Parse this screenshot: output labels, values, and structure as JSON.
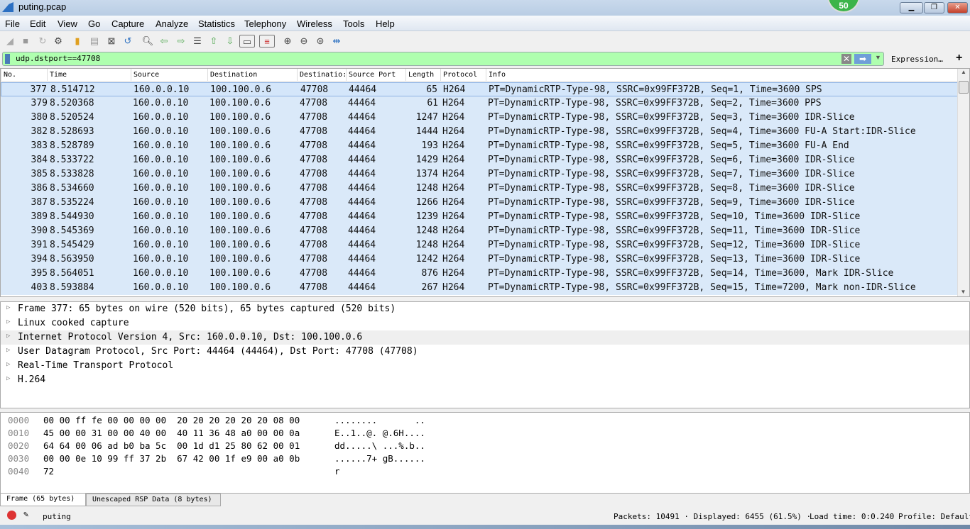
{
  "window": {
    "title": "puting.pcap",
    "badge": "50"
  },
  "menu": [
    "File",
    "Edit",
    "View",
    "Go",
    "Capture",
    "Analyze",
    "Statistics",
    "Telephony",
    "Wireless",
    "Tools",
    "Help"
  ],
  "filter": {
    "value": "udp.dstport==47708",
    "expression_label": "Expression…",
    "add_label": "+"
  },
  "columns": [
    "No.",
    "Time",
    "Source",
    "Destination",
    "Destinatio:",
    "Source Port",
    "Length",
    "Protocol",
    "Info"
  ],
  "packets": [
    [
      "377",
      "8.514712",
      "160.0.0.10",
      "100.100.0.6",
      "47708",
      "44464",
      "65",
      "H264",
      "PT=DynamicRTP-Type-98, SSRC=0x99FF372B, Seq=1, Time=3600 SPS"
    ],
    [
      "379",
      "8.520368",
      "160.0.0.10",
      "100.100.0.6",
      "47708",
      "44464",
      "61",
      "H264",
      "PT=DynamicRTP-Type-98, SSRC=0x99FF372B, Seq=2, Time=3600 PPS"
    ],
    [
      "380",
      "8.520524",
      "160.0.0.10",
      "100.100.0.6",
      "47708",
      "44464",
      "1247",
      "H264",
      "PT=DynamicRTP-Type-98, SSRC=0x99FF372B, Seq=3, Time=3600 IDR-Slice"
    ],
    [
      "382",
      "8.528693",
      "160.0.0.10",
      "100.100.0.6",
      "47708",
      "44464",
      "1444",
      "H264",
      "PT=DynamicRTP-Type-98, SSRC=0x99FF372B, Seq=4, Time=3600 FU-A Start:IDR-Slice"
    ],
    [
      "383",
      "8.528789",
      "160.0.0.10",
      "100.100.0.6",
      "47708",
      "44464",
      "193",
      "H264",
      "PT=DynamicRTP-Type-98, SSRC=0x99FF372B, Seq=5, Time=3600 FU-A End"
    ],
    [
      "384",
      "8.533722",
      "160.0.0.10",
      "100.100.0.6",
      "47708",
      "44464",
      "1429",
      "H264",
      "PT=DynamicRTP-Type-98, SSRC=0x99FF372B, Seq=6, Time=3600 IDR-Slice"
    ],
    [
      "385",
      "8.533828",
      "160.0.0.10",
      "100.100.0.6",
      "47708",
      "44464",
      "1374",
      "H264",
      "PT=DynamicRTP-Type-98, SSRC=0x99FF372B, Seq=7, Time=3600 IDR-Slice"
    ],
    [
      "386",
      "8.534660",
      "160.0.0.10",
      "100.100.0.6",
      "47708",
      "44464",
      "1248",
      "H264",
      "PT=DynamicRTP-Type-98, SSRC=0x99FF372B, Seq=8, Time=3600 IDR-Slice"
    ],
    [
      "387",
      "8.535224",
      "160.0.0.10",
      "100.100.0.6",
      "47708",
      "44464",
      "1266",
      "H264",
      "PT=DynamicRTP-Type-98, SSRC=0x99FF372B, Seq=9, Time=3600 IDR-Slice"
    ],
    [
      "389",
      "8.544930",
      "160.0.0.10",
      "100.100.0.6",
      "47708",
      "44464",
      "1239",
      "H264",
      "PT=DynamicRTP-Type-98, SSRC=0x99FF372B, Seq=10, Time=3600 IDR-Slice"
    ],
    [
      "390",
      "8.545369",
      "160.0.0.10",
      "100.100.0.6",
      "47708",
      "44464",
      "1248",
      "H264",
      "PT=DynamicRTP-Type-98, SSRC=0x99FF372B, Seq=11, Time=3600 IDR-Slice"
    ],
    [
      "391",
      "8.545429",
      "160.0.0.10",
      "100.100.0.6",
      "47708",
      "44464",
      "1248",
      "H264",
      "PT=DynamicRTP-Type-98, SSRC=0x99FF372B, Seq=12, Time=3600 IDR-Slice"
    ],
    [
      "394",
      "8.563950",
      "160.0.0.10",
      "100.100.0.6",
      "47708",
      "44464",
      "1242",
      "H264",
      "PT=DynamicRTP-Type-98, SSRC=0x99FF372B, Seq=13, Time=3600 IDR-Slice"
    ],
    [
      "395",
      "8.564051",
      "160.0.0.10",
      "100.100.0.6",
      "47708",
      "44464",
      "876",
      "H264",
      "PT=DynamicRTP-Type-98, SSRC=0x99FF372B, Seq=14, Time=3600, Mark IDR-Slice"
    ],
    [
      "403",
      "8.593884",
      "160.0.0.10",
      "100.100.0.6",
      "47708",
      "44464",
      "267",
      "H264",
      "PT=DynamicRTP-Type-98, SSRC=0x99FF372B, Seq=15, Time=7200, Mark non-IDR-Slice"
    ]
  ],
  "details": [
    "Frame 377: 65 bytes on wire (520 bits), 65 bytes captured (520 bits)",
    "Linux cooked capture",
    "Internet Protocol Version 4, Src: 160.0.0.10, Dst: 100.100.0.6",
    "User Datagram Protocol, Src Port: 44464 (44464), Dst Port: 47708 (47708)",
    "Real-Time Transport Protocol",
    "H.264"
  ],
  "hex": [
    [
      "0000",
      "00 00 ff fe 00 00 00 00  20 20 20 20 20 20 08 00",
      "........       .."
    ],
    [
      "0010",
      "45 00 00 31 00 00 40 00  40 11 36 48 a0 00 00 0a",
      "E..1..@. @.6H...."
    ],
    [
      "0020",
      "64 64 00 06 ad b0 ba 5c  00 1d d1 25 80 62 00 01",
      "dd.....\\ ...%.b.."
    ],
    [
      "0030",
      "00 00 0e 10 99 ff 37 2b  67 42 00 1f e9 00 a0 0b",
      "......7+ gB......"
    ],
    [
      "0040",
      "72",
      "r"
    ]
  ],
  "tabs": [
    "Frame (65 bytes)",
    "Unescaped RSP Data (8 bytes)"
  ],
  "status": {
    "profile_name": "puting",
    "packets": "Packets: 10491 · Displayed: 6455 (61.5%) · ",
    "load": "Load time: 0:0.240",
    "profile": "Profile: Default"
  },
  "colors": {
    "row": "#dae9f9",
    "filter_ok": "#afffaf"
  }
}
